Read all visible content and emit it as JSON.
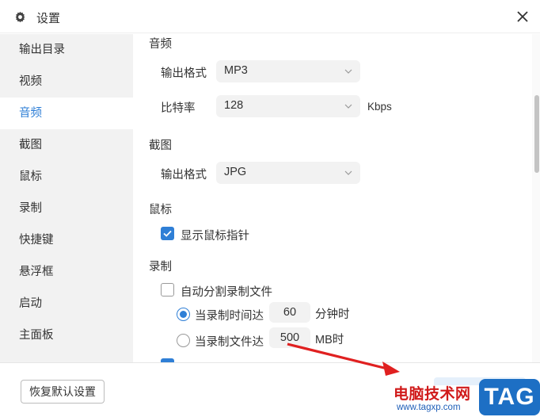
{
  "window": {
    "title": "设置"
  },
  "sidebar": {
    "items": [
      {
        "label": "输出目录"
      },
      {
        "label": "视频"
      },
      {
        "label": "音频"
      },
      {
        "label": "截图"
      },
      {
        "label": "鼠标"
      },
      {
        "label": "录制"
      },
      {
        "label": "快捷键"
      },
      {
        "label": "悬浮框"
      },
      {
        "label": "启动"
      },
      {
        "label": "主面板"
      }
    ],
    "active": "音频"
  },
  "audio": {
    "heading": "音频",
    "format_label": "输出格式",
    "format_value": "MP3",
    "bitrate_label": "比特率",
    "bitrate_value": "128",
    "bitrate_unit": "Kbps"
  },
  "screenshot": {
    "heading": "截图",
    "format_label": "输出格式",
    "format_value": "JPG"
  },
  "mouse": {
    "heading": "鼠标",
    "show_pointer_label": "显示鼠标指针",
    "show_pointer_checked": true
  },
  "recording": {
    "heading": "录制",
    "auto_split_label": "自动分割录制文件",
    "auto_split_checked": false,
    "by_time_label": "当录制时间达",
    "by_time_value": "60",
    "by_time_unit": "分钟时",
    "by_time_selected": true,
    "by_size_label": "当录制文件达",
    "by_size_value": "500",
    "by_size_unit": "MB时",
    "by_size_selected": false
  },
  "footer": {
    "reset_label": "恢复默认设置"
  },
  "watermark": {
    "text": "电脑技术网",
    "url": "www.tagxp.com",
    "tag": "TAG"
  },
  "colors": {
    "accent": "#2f7fd6",
    "sidebar_bg": "#f2f2f2",
    "watermark_red": "#d01a1a",
    "watermark_blue": "#1d6fc4"
  }
}
